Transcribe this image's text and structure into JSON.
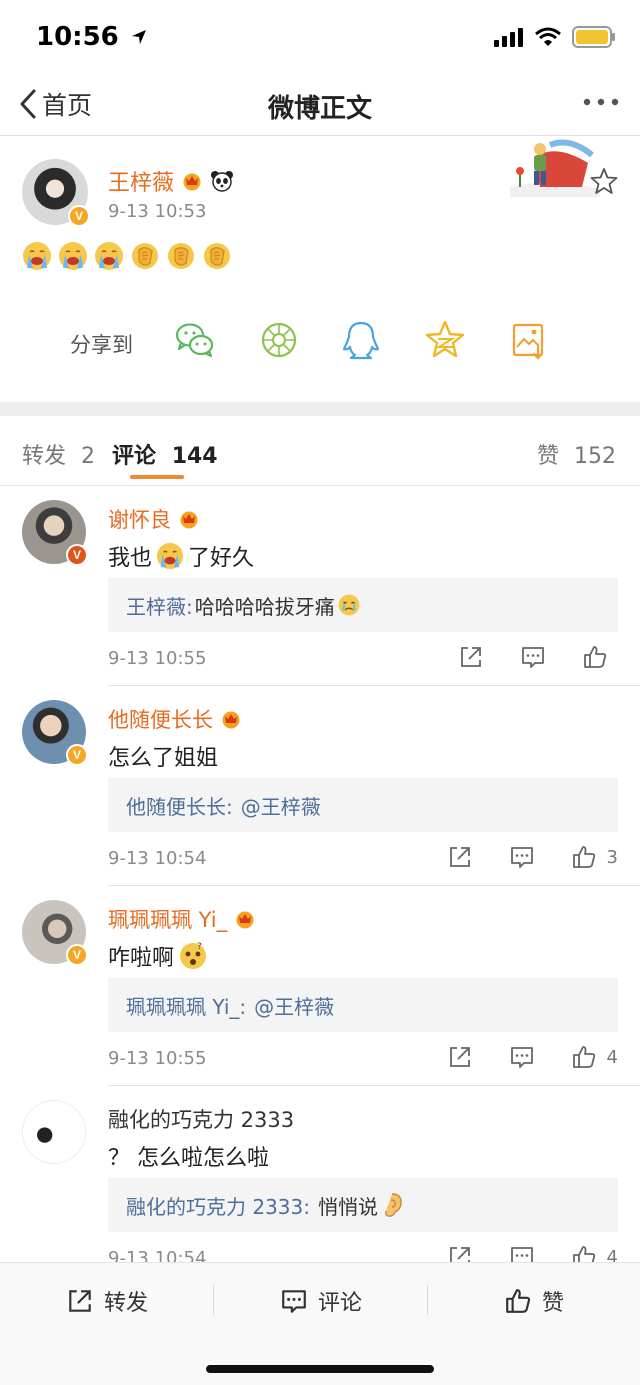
{
  "status_bar": {
    "time": "10:56"
  },
  "nav": {
    "back_label": "首页",
    "title": "微博正文"
  },
  "post": {
    "author": "王梓薇",
    "time": "9-13 10:53",
    "emojis": [
      "crying-emoji",
      "crying-emoji",
      "crying-emoji",
      "clap-emoji",
      "clap-emoji",
      "clap-emoji"
    ],
    "share_label": "分享到",
    "share_targets": [
      "wechat-icon",
      "moments-icon",
      "qq-icon",
      "qzone-icon",
      "save-image-icon"
    ]
  },
  "tabs": {
    "repost_label": "转发",
    "repost_count": "2",
    "comment_label": "评论",
    "comment_count": "144",
    "like_label": "赞",
    "like_count": "152"
  },
  "comments": [
    {
      "user": "谢怀良",
      "text_before": "我也",
      "text_after": "了好久",
      "reply_name": "王梓薇:",
      "reply_text": "哈哈哈哈拔牙痛",
      "time": "9-13 10:55",
      "likes": ""
    },
    {
      "user": "他随便长长",
      "text_before": "怎么了姐姐",
      "text_after": "",
      "reply_name": "他随便长长:",
      "reply_text": "@王梓薇",
      "time": "9-13 10:54",
      "likes": "3"
    },
    {
      "user": "珮珮珮珮 Yi_",
      "text_before": "咋啦啊",
      "text_after": "",
      "reply_name": "珮珮珮珮 Yi_:",
      "reply_text": "@王梓薇",
      "time": "9-13 10:55",
      "likes": "4"
    },
    {
      "user": "融化的巧克力 2333",
      "text_before": "？ 怎么啦怎么啦",
      "text_after": "",
      "reply_name": "融化的巧克力 2333:",
      "reply_text": "悄悄说",
      "time": "9-13 10:54",
      "likes": "4"
    }
  ],
  "bottom_bar": {
    "repost": "转发",
    "comment": "评论",
    "like": "赞"
  },
  "colors": {
    "accent": "#f08a30",
    "username": "#e86b1f",
    "reply_name": "#4e6e9a",
    "verified": "#f5a623"
  }
}
